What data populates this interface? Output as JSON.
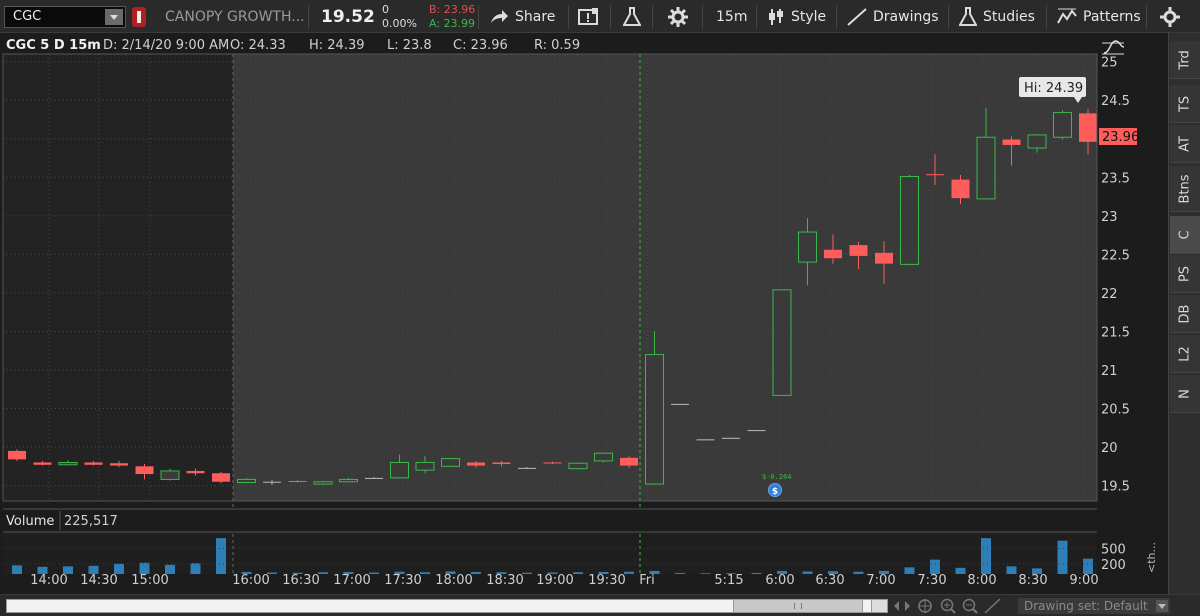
{
  "toolbar": {
    "symbol": "CGC",
    "company": "CANOPY GROWTH...",
    "last": "19.52",
    "net_change": "0",
    "pct_change": "0.00%",
    "bid": "B: 23.96",
    "ask": "A: 23.99",
    "share_label": "Share",
    "timeframe": "15m",
    "style_label": "Style",
    "drawings_label": "Drawings",
    "studies_label": "Studies",
    "patterns_label": "Patterns",
    "colors": {
      "bid": "#e05050",
      "ask": "#3cb84a"
    }
  },
  "header": {
    "info": "CGC 5 D 15m",
    "date": "D: 2/14/20 9:00 AM",
    "open": "O: 24.33",
    "high": "H: 24.39",
    "low": "L: 23.8",
    "close": "C: 23.96",
    "range": "R: 0.59"
  },
  "price_axis": {
    "ticks": [
      "25",
      "24.5",
      "24",
      "23.5",
      "23",
      "22.5",
      "22",
      "21.5",
      "21",
      "20.5",
      "20",
      "19.5"
    ],
    "last_price_label": "23.96",
    "hi_label": "Hi: 24.39"
  },
  "volume": {
    "label": "Volume",
    "value": "225,517",
    "ticks": [
      "500",
      "200"
    ]
  },
  "time_axis": {
    "labels": [
      "14:00",
      "14:30",
      "15:00",
      "16:00",
      "16:30",
      "17:00",
      "17:30",
      "18:00",
      "18:30",
      "19:00",
      "19:30",
      "Fri",
      "5:15",
      "6:00",
      "6:30",
      "7:00",
      "7:30",
      "8:00",
      "8:30",
      "9:00"
    ]
  },
  "event_marker": {
    "label": "$-0.264"
  },
  "side_tabs": [
    "Trd",
    "TS",
    "AT",
    "Btns",
    "C",
    "PS",
    "DB",
    "L2",
    "N"
  ],
  "side_overflow": "<th...",
  "bottom": {
    "drawing_set": "Drawing set: Default"
  },
  "chart_data": {
    "type": "candlestick",
    "ylim": [
      19.3,
      25.1
    ],
    "volume_ylim": [
      0,
      800
    ],
    "colors": {
      "up": "#3cb84a",
      "down": "#ff5c5c",
      "flat": "#bbbbbb",
      "volume": "#2e7fb5"
    },
    "candles": [
      {
        "o": 19.95,
        "h": 19.97,
        "l": 19.82,
        "c": 19.84,
        "v": 170
      },
      {
        "o": 19.8,
        "h": 19.82,
        "l": 19.76,
        "c": 19.77,
        "v": 140
      },
      {
        "o": 19.77,
        "h": 19.83,
        "l": 19.76,
        "c": 19.8,
        "v": 150
      },
      {
        "o": 19.8,
        "h": 19.82,
        "l": 19.76,
        "c": 19.77,
        "v": 160
      },
      {
        "o": 19.79,
        "h": 19.82,
        "l": 19.74,
        "c": 19.76,
        "v": 200
      },
      {
        "o": 19.75,
        "h": 19.78,
        "l": 19.58,
        "c": 19.65,
        "v": 220
      },
      {
        "o": 19.58,
        "h": 19.72,
        "l": 19.57,
        "c": 19.69,
        "v": 180
      },
      {
        "o": 19.69,
        "h": 19.72,
        "l": 19.63,
        "c": 19.66,
        "v": 210
      },
      {
        "o": 19.66,
        "h": 19.68,
        "l": 19.53,
        "c": 19.55,
        "v": 700
      },
      {
        "o": 19.54,
        "h": 19.6,
        "l": 19.53,
        "c": 19.58,
        "v": 40
      },
      {
        "o": 19.55,
        "h": 19.57,
        "l": 19.51,
        "c": 19.55,
        "v": 30
      },
      {
        "o": 19.56,
        "h": 19.57,
        "l": 19.54,
        "c": 19.55,
        "v": 25
      },
      {
        "o": 19.52,
        "h": 19.56,
        "l": 19.51,
        "c": 19.55,
        "v": 35
      },
      {
        "o": 19.55,
        "h": 19.6,
        "l": 19.54,
        "c": 19.58,
        "v": 40
      },
      {
        "o": 19.6,
        "h": 19.61,
        "l": 19.59,
        "c": 19.6,
        "v": 30
      },
      {
        "o": 19.6,
        "h": 19.9,
        "l": 19.59,
        "c": 19.8,
        "v": 45
      },
      {
        "o": 19.7,
        "h": 19.88,
        "l": 19.66,
        "c": 19.8,
        "v": 35
      },
      {
        "o": 19.75,
        "h": 19.86,
        "l": 19.74,
        "c": 19.85,
        "v": 50
      },
      {
        "o": 19.8,
        "h": 19.82,
        "l": 19.73,
        "c": 19.76,
        "v": 40
      },
      {
        "o": 19.8,
        "h": 19.82,
        "l": 19.75,
        "c": 19.78,
        "v": 35
      },
      {
        "o": 19.73,
        "h": 19.74,
        "l": 19.72,
        "c": 19.73,
        "v": 25
      },
      {
        "o": 19.8,
        "h": 19.81,
        "l": 19.78,
        "c": 19.79,
        "v": 30
      },
      {
        "o": 19.72,
        "h": 19.8,
        "l": 19.71,
        "c": 19.79,
        "v": 35
      },
      {
        "o": 19.82,
        "h": 19.93,
        "l": 19.8,
        "c": 19.92,
        "v": 40
      },
      {
        "o": 19.86,
        "h": 19.88,
        "l": 19.73,
        "c": 19.76,
        "v": 45
      },
      {
        "o": 19.52,
        "h": 21.5,
        "l": 19.52,
        "c": 21.2,
        "v": 60
      },
      {
        "o": 20.56,
        "h": 20.56,
        "l": 20.55,
        "c": 20.56,
        "v": 20
      },
      {
        "o": 20.1,
        "h": 20.1,
        "l": 20.09,
        "c": 20.1,
        "v": 15
      },
      {
        "o": 20.12,
        "h": 20.12,
        "l": 20.11,
        "c": 20.12,
        "v": 15
      },
      {
        "o": 20.22,
        "h": 20.22,
        "l": 20.21,
        "c": 20.22,
        "v": 20
      },
      {
        "o": 20.67,
        "h": 20.67,
        "l": 20.67,
        "c": 22.04,
        "v": 60
      },
      {
        "o": 22.4,
        "h": 22.97,
        "l": 22.1,
        "c": 22.79,
        "v": 50
      },
      {
        "o": 22.56,
        "h": 22.76,
        "l": 22.38,
        "c": 22.45,
        "v": 55
      },
      {
        "o": 22.62,
        "h": 22.66,
        "l": 22.31,
        "c": 22.48,
        "v": 45
      },
      {
        "o": 22.52,
        "h": 22.67,
        "l": 22.12,
        "c": 22.38,
        "v": 60
      },
      {
        "o": 22.37,
        "h": 23.53,
        "l": 22.37,
        "c": 23.51,
        "v": 130
      },
      {
        "o": 23.54,
        "h": 23.8,
        "l": 23.4,
        "c": 23.53,
        "v": 280
      },
      {
        "o": 23.47,
        "h": 23.53,
        "l": 23.15,
        "c": 23.23,
        "v": 120
      },
      {
        "o": 23.22,
        "h": 24.4,
        "l": 23.22,
        "c": 24.02,
        "v": 700
      },
      {
        "o": 23.99,
        "h": 24.03,
        "l": 23.65,
        "c": 23.92,
        "v": 150
      },
      {
        "o": 23.88,
        "h": 24.04,
        "l": 23.82,
        "c": 24.05,
        "v": 110
      },
      {
        "o": 24.02,
        "h": 24.37,
        "l": 23.99,
        "c": 24.34,
        "v": 650
      },
      {
        "o": 24.33,
        "h": 24.39,
        "l": 23.8,
        "c": 23.96,
        "v": 300
      }
    ]
  }
}
